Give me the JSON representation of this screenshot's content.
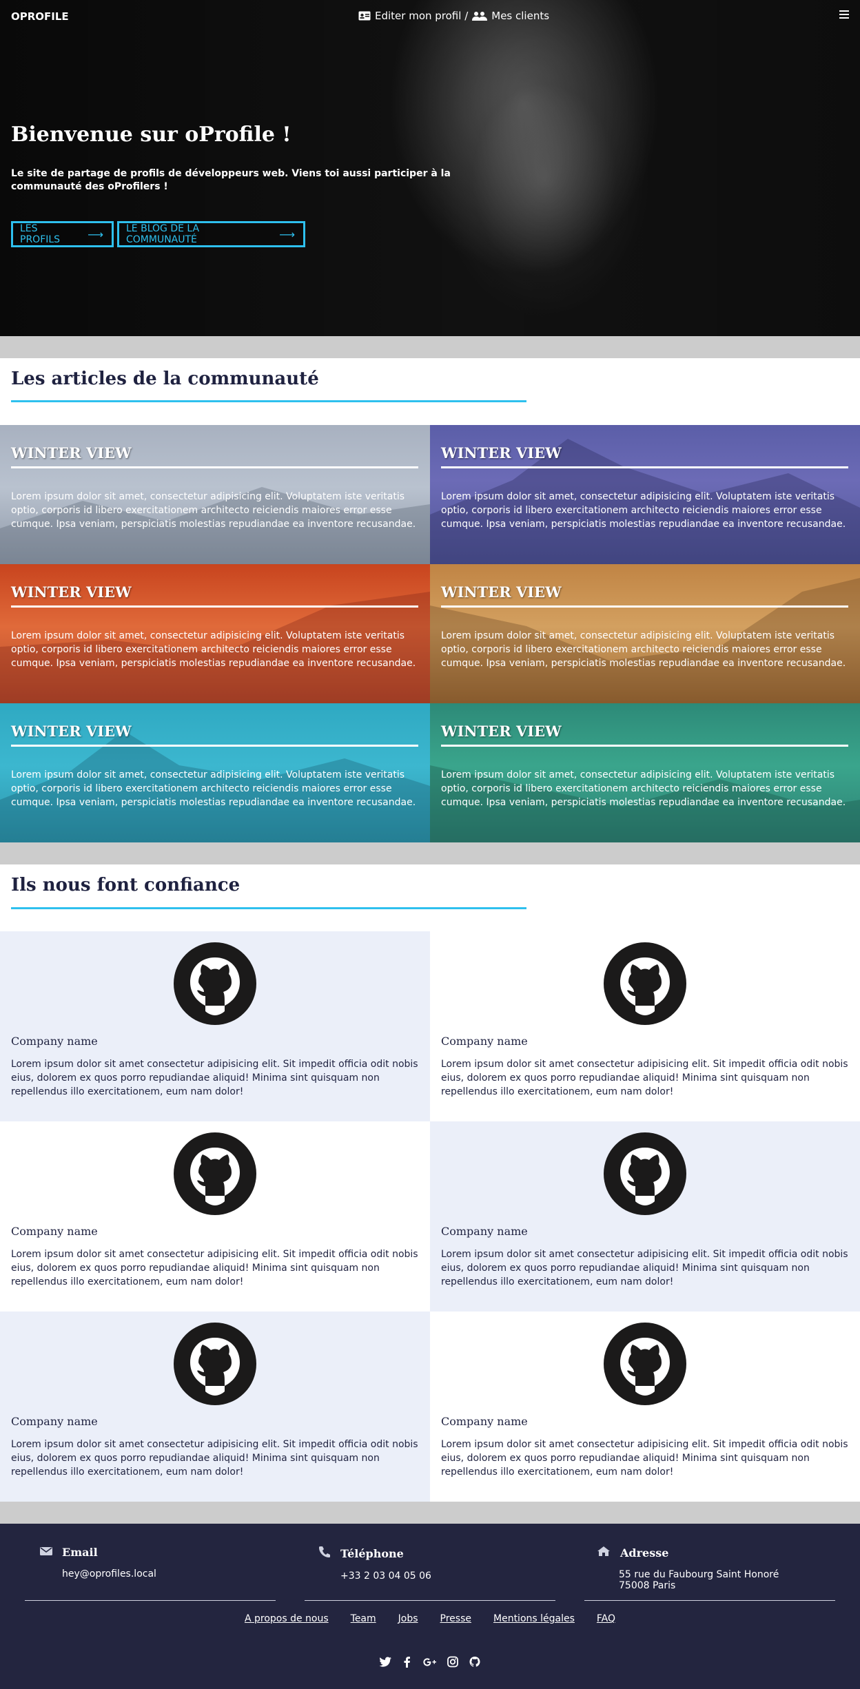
{
  "nav": {
    "brand": "OPROFILE",
    "edit_profile": "Editer mon profil /",
    "clients": "Mes clients",
    "icons": [
      "id-card-icon",
      "users-icon",
      "menu-icon"
    ]
  },
  "hero": {
    "title": "Bienvenue sur oProfile !",
    "subtitle": "Le site de partage de profils de développeurs web. Viens toi aussi participer à la communauté des oProfilers !",
    "button_profiles": "LES PROFILS",
    "button_blog": "LE BLOG DE LA COMMUNAUTÉ",
    "arrow": "⟶"
  },
  "articles": {
    "title": "Les articles de la communauté",
    "items": [
      {
        "title": "WINTER VIEW",
        "text": "Lorem ipsum dolor sit amet, consectetur adipisicing elit. Voluptatem iste veritatis optio, corporis id libero exercitationem architecto reiciendis maiores error esse cumque. Ipsa veniam, perspiciatis molestias repudiandae ea inventore recusandae."
      },
      {
        "title": "WINTER VIEW",
        "text": "Lorem ipsum dolor sit amet, consectetur adipisicing elit. Voluptatem iste veritatis optio, corporis id libero exercitationem architecto reiciendis maiores error esse cumque. Ipsa veniam, perspiciatis molestias repudiandae ea inventore recusandae."
      },
      {
        "title": "WINTER VIEW",
        "text": "Lorem ipsum dolor sit amet, consectetur adipisicing elit. Voluptatem iste veritatis optio, corporis id libero exercitationem architecto reiciendis maiores error esse cumque. Ipsa veniam, perspiciatis molestias repudiandae ea inventore recusandae."
      },
      {
        "title": "WINTER VIEW",
        "text": "Lorem ipsum dolor sit amet, consectetur adipisicing elit. Voluptatem iste veritatis optio, corporis id libero exercitationem architecto reiciendis maiores error esse cumque. Ipsa veniam, perspiciatis molestias repudiandae ea inventore recusandae."
      },
      {
        "title": "WINTER VIEW",
        "text": "Lorem ipsum dolor sit amet, consectetur adipisicing elit. Voluptatem iste veritatis optio, corporis id libero exercitationem architecto reiciendis maiores error esse cumque. Ipsa veniam, perspiciatis molestias repudiandae ea inventore recusandae."
      },
      {
        "title": "WINTER VIEW",
        "text": "Lorem ipsum dolor sit amet, consectetur adipisicing elit. Voluptatem iste veritatis optio, corporis id libero exercitationem architecto reiciendis maiores error esse cumque. Ipsa veniam, perspiciatis molestias repudiandae ea inventore recusandae."
      }
    ]
  },
  "clients": {
    "title": "Ils nous font confiance",
    "items": [
      {
        "name": "Company name",
        "text": "Lorem ipsum dolor sit amet consectetur adipisicing elit. Sit impedit officia odit nobis eius, dolorem ex quos porro repudiandae aliquid! Minima sint quisquam non repellendus illo exercitationem, eum nam dolor!",
        "icon": "github-icon"
      },
      {
        "name": "Company name",
        "text": "Lorem ipsum dolor sit amet consectetur adipisicing elit. Sit impedit officia odit nobis eius, dolorem ex quos porro repudiandae aliquid! Minima sint quisquam non repellendus illo exercitationem, eum nam dolor!",
        "icon": "github-icon"
      },
      {
        "name": "Company name",
        "text": "Lorem ipsum dolor sit amet consectetur adipisicing elit. Sit impedit officia odit nobis eius, dolorem ex quos porro repudiandae aliquid! Minima sint quisquam non repellendus illo exercitationem, eum nam dolor!",
        "icon": "github-icon"
      },
      {
        "name": "Company name",
        "text": "Lorem ipsum dolor sit amet consectetur adipisicing elit. Sit impedit officia odit nobis eius, dolorem ex quos porro repudiandae aliquid! Minima sint quisquam non repellendus illo exercitationem, eum nam dolor!",
        "icon": "github-icon"
      },
      {
        "name": "Company name",
        "text": "Lorem ipsum dolor sit amet consectetur adipisicing elit. Sit impedit officia odit nobis eius, dolorem ex quos porro repudiandae aliquid! Minima sint quisquam non repellendus illo exercitationem, eum nam dolor!",
        "icon": "github-icon"
      },
      {
        "name": "Company name",
        "text": "Lorem ipsum dolor sit amet consectetur adipisicing elit. Sit impedit officia odit nobis eius, dolorem ex quos porro repudiandae aliquid! Minima sint quisquam non repellendus illo exercitationem, eum nam dolor!",
        "icon": "github-icon"
      }
    ]
  },
  "footer": {
    "email_label": "Email",
    "email_value": "hey@oprofiles.local",
    "phone_label": "Téléphone",
    "phone_value": "+33 2 03 04 05 06",
    "address_label": "Adresse",
    "address_line1": "55 rue du Faubourg Saint Honoré",
    "address_line2": "75008 Paris",
    "links": [
      "A propos de nous",
      "Team",
      "Jobs",
      "Presse",
      "Mentions légales",
      "FAQ"
    ],
    "social": [
      "twitter-icon",
      "facebook-icon",
      "google-plus-icon",
      "instagram-icon",
      "github-icon"
    ]
  },
  "colors": {
    "accent": "#2ec0ee",
    "dark": "#23253f",
    "band": "#cccccc",
    "alt_row": "#ebeff9"
  }
}
